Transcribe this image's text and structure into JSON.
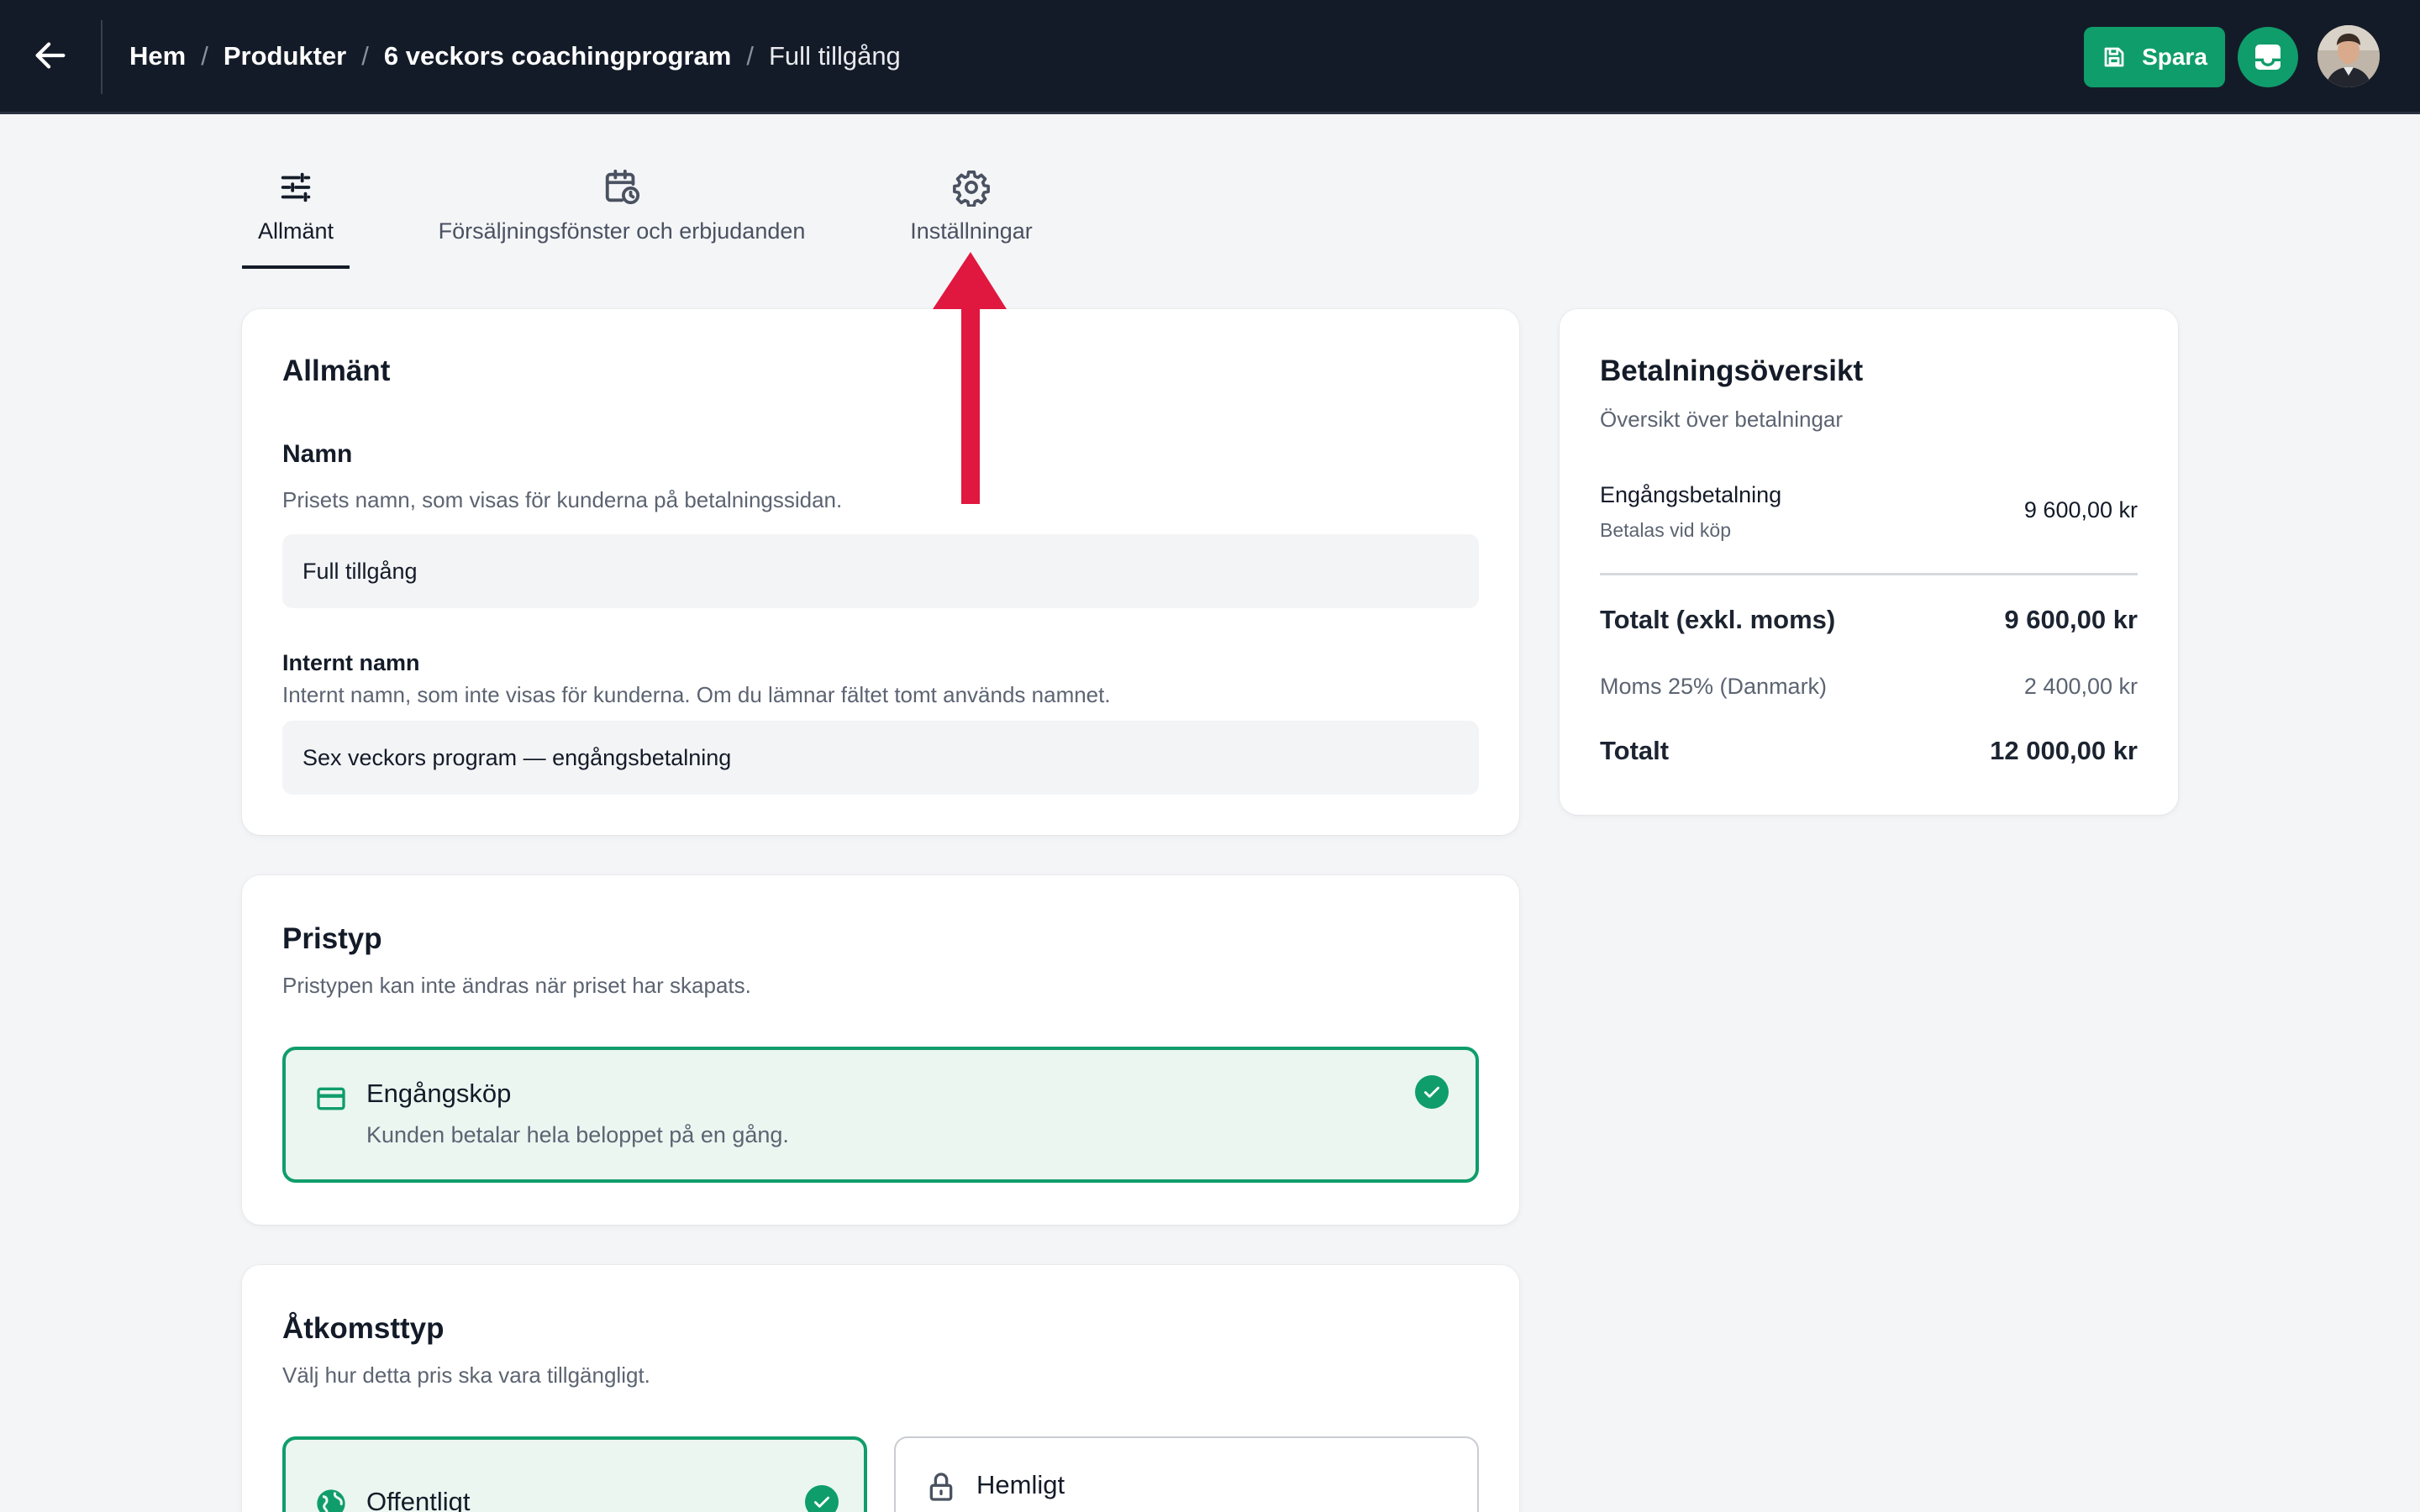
{
  "header": {
    "breadcrumb": [
      "Hem",
      "Produkter",
      "6 veckors coachingprogram",
      "Full tillgång"
    ],
    "separator": "/",
    "save_label": "Spara",
    "accent_color": "#0f9d6b",
    "background_color": "#141b28"
  },
  "tabs": [
    {
      "label": "Allmänt",
      "icon": "sliders-icon",
      "active": true
    },
    {
      "label": "Försäljningsfönster och erbjudanden",
      "icon": "calendar-clock-icon",
      "active": false
    },
    {
      "label": "Inställningar",
      "icon": "gear-icon",
      "active": false
    }
  ],
  "general": {
    "title": "Allmänt",
    "name_label": "Namn",
    "name_help": "Prisets namn, som visas för kunderna på betalningssidan.",
    "name_value": "Full tillgång",
    "internal_label": "Internt namn",
    "internal_help": "Internt namn, som inte visas för kunderna. Om du lämnar fältet tomt används namnet.",
    "internal_value": "Sex veckors program — engångsbetalning"
  },
  "price_type": {
    "title": "Pristyp",
    "help": "Pristypen kan inte ändras när priset har skapats.",
    "option": {
      "title": "Engångsköp",
      "desc": "Kunden betalar hela beloppet på en gång.",
      "icon": "credit-card-icon",
      "selected": true
    }
  },
  "access_type": {
    "title": "Åtkomsttyp",
    "help": "Välj hur detta pris ska vara tillgängligt.",
    "options": [
      {
        "title": "Offentligt",
        "icon": "globe-icon",
        "selected": true
      },
      {
        "title": "Hemligt",
        "icon": "lock-icon",
        "selected": false
      }
    ]
  },
  "summary": {
    "title": "Betalningsöversikt",
    "subtitle": "Översikt över betalningar",
    "item_label": "Engångsbetalning",
    "item_sub": "Betalas vid köp",
    "item_amount": "9 600,00 kr",
    "subtotal_label": "Totalt (exkl. moms)",
    "subtotal_amount": "9 600,00 kr",
    "vat_label": "Moms 25% (Danmark)",
    "vat_amount": "2 400,00 kr",
    "total_label": "Totalt",
    "total_amount": "12 000,00 kr"
  },
  "annotation": {
    "arrow_color": "#e0173f"
  }
}
